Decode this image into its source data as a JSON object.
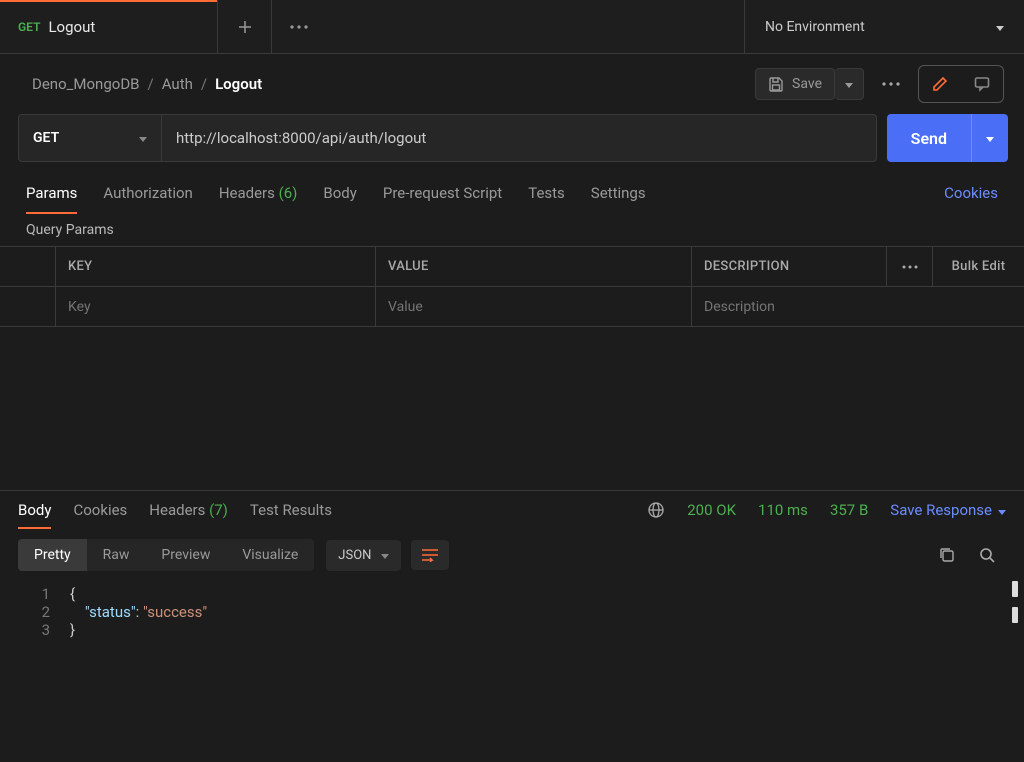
{
  "tab": {
    "method": "GET",
    "title": "Logout"
  },
  "environment": {
    "selected": "No Environment"
  },
  "breadcrumbs": {
    "seg1": "Deno_MongoDB",
    "seg2": "Auth",
    "seg3": "Logout"
  },
  "toolbar": {
    "save_label": "Save"
  },
  "request": {
    "method": "GET",
    "url": "http://localhost:8000/api/auth/logout",
    "send_label": "Send"
  },
  "request_tabs": {
    "params": "Params",
    "auth": "Authorization",
    "headers_label": "Headers",
    "headers_count": "(6)",
    "body": "Body",
    "prerequest": "Pre-request Script",
    "tests": "Tests",
    "settings": "Settings",
    "cookies": "Cookies"
  },
  "query_params": {
    "section_label": "Query Params",
    "col_key": "KEY",
    "col_value": "VALUE",
    "col_desc": "DESCRIPTION",
    "bulk_edit": "Bulk Edit",
    "placeholder_key": "Key",
    "placeholder_value": "Value",
    "placeholder_desc": "Description"
  },
  "response_tabs": {
    "body": "Body",
    "cookies": "Cookies",
    "headers_label": "Headers",
    "headers_count": "(7)",
    "test_results": "Test Results"
  },
  "response_status": {
    "code": "200",
    "text": "OK",
    "time": "110 ms",
    "size": "357 B",
    "save_label": "Save Response"
  },
  "view_modes": {
    "pretty": "Pretty",
    "raw": "Raw",
    "preview": "Preview",
    "visualize": "Visualize",
    "format": "JSON"
  },
  "response_body": {
    "line1_num": "1",
    "line1_txt": "{",
    "line2_num": "2",
    "line2_key": "\"status\"",
    "line2_sep": ": ",
    "line2_val": "\"success\"",
    "line3_num": "3",
    "line3_txt": "}"
  }
}
